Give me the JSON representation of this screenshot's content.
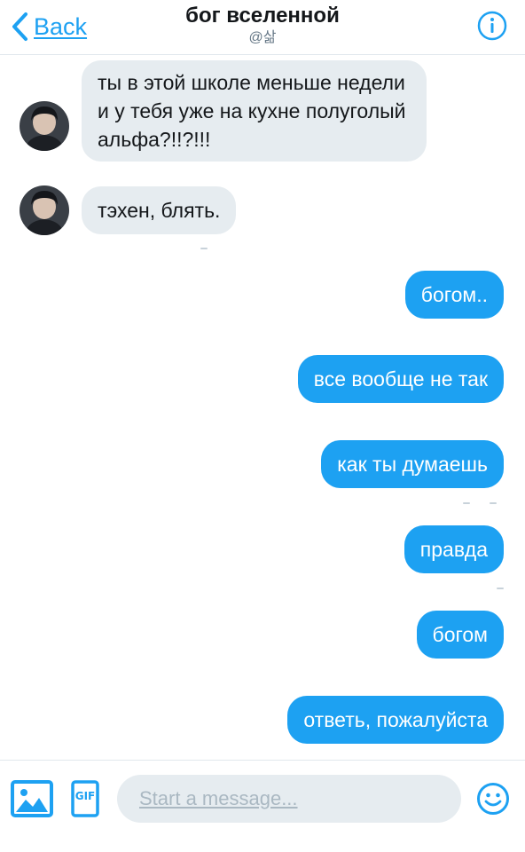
{
  "header": {
    "back_label": "Back",
    "title": "бог вселенной",
    "subtitle": "@삶"
  },
  "messages": {
    "incoming": [
      "ты в этой школе меньше недели и у тебя уже на кухне полуголый альфа?!!?!!!",
      "тэхен, блять."
    ],
    "outgoing": [
      "богом..",
      "все вообще не так",
      "как ты думаешь",
      "правда",
      "богом",
      "ответь, пожалуйста"
    ]
  },
  "composer": {
    "placeholder": "Start a message...",
    "gif_label": "GIF"
  },
  "colors": {
    "accent": "#1da1f2",
    "incoming_bubble": "#e6ecf0",
    "outgoing_bubble": "#1da1f2"
  }
}
